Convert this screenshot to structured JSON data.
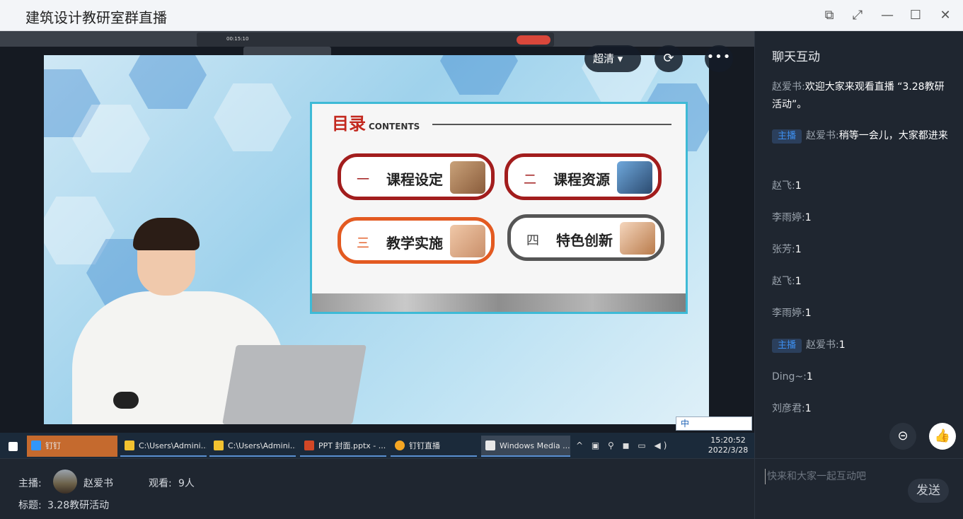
{
  "window": {
    "title": "建筑设计教研室群直播",
    "buttons": {
      "minimize": "—",
      "maximize": "☐",
      "close": "✕",
      "fullscreen": "⤢",
      "popout": "⧉"
    }
  },
  "player": {
    "quality_label": "超清",
    "quality_caret": "▾",
    "rotate_icon": "⟳",
    "more_icon": "•••"
  },
  "slide": {
    "heading": "目录",
    "heading_sub": "CONTENTS",
    "items": [
      {
        "num": "一",
        "label": "课程设定"
      },
      {
        "num": "二",
        "label": "课程资源"
      },
      {
        "num": "三",
        "label": "教学实施"
      },
      {
        "num": "四",
        "label": "特色创新"
      }
    ]
  },
  "shared_screen": {
    "timer": "00:15:10"
  },
  "ime_bar": {
    "text": "中"
  },
  "taskbar": {
    "items": [
      {
        "label": "钉钉",
        "color": "#3296fa"
      },
      {
        "label": "C:\\Users\\Admini...",
        "color": "#f2c230"
      },
      {
        "label": "C:\\Users\\Admini...",
        "color": "#f2c230"
      },
      {
        "label": "PPT 封面.pptx - ...",
        "color": "#d24726"
      },
      {
        "label": "钉钉直播",
        "color": "#f5a623"
      },
      {
        "label": "Windows Media ...",
        "color": "#e8e8e8"
      }
    ],
    "tray_lang": "中",
    "time": "15:20:52",
    "date": "2022/3/28"
  },
  "info": {
    "host_label": "主播:",
    "host_name": "赵爱书",
    "viewers_label": "观看:",
    "viewers_value": "9人",
    "topic_label": "标题:",
    "topic_value": "3.28教研活动"
  },
  "chat": {
    "title": "聊天互动",
    "host_badge": "主播",
    "messages": [
      {
        "name": "赵爱书:",
        "text": "欢迎大家来观看直播 “3.28教研活动”。",
        "host": false
      },
      {
        "name": "赵爱书:",
        "text": "稍等一会儿，大家都进来",
        "host": true
      },
      {
        "name": "赵飞:",
        "text": "1",
        "host": false
      },
      {
        "name": "李雨婷:",
        "text": "1",
        "host": false
      },
      {
        "name": "张芳:",
        "text": "1",
        "host": false
      },
      {
        "name": "赵飞:",
        "text": "1",
        "host": false
      },
      {
        "name": "李雨婷:",
        "text": "1",
        "host": false
      },
      {
        "name": "赵爱书:",
        "text": "1",
        "host": true
      },
      {
        "name": "Ding~:",
        "text": "1",
        "host": false
      },
      {
        "name": "刘彦君:",
        "text": "1",
        "host": false
      }
    ],
    "input_placeholder": "快来和大家一起互动吧",
    "send_label": "发送",
    "link_icon": "⊝",
    "like_icon": "👍"
  }
}
